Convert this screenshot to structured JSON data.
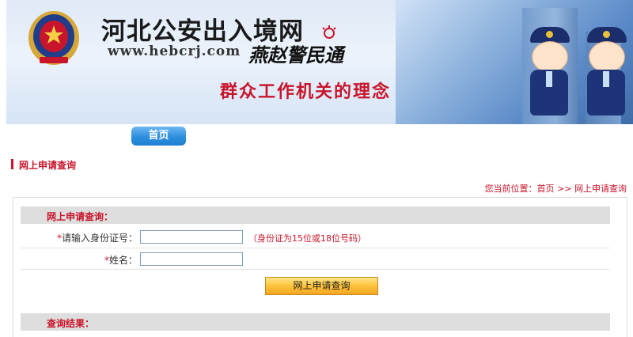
{
  "banner": {
    "site_title": "河北公安出入境网",
    "site_url": "www.hebcrj.com",
    "brand": "燕赵警民通",
    "slogan": "群众工作机关的理念"
  },
  "nav": {
    "home_label": "首页"
  },
  "section": {
    "title": "网上申请查询"
  },
  "breadcrumb": {
    "prefix": "您当前位置：",
    "home": "首页",
    "separator": ">>",
    "current": "网上申请查询"
  },
  "form": {
    "heading": "网上申请查询：",
    "required_mark": "*",
    "id_label": "请输入身份证号：",
    "id_value": "",
    "id_hint": "（身份证为15位或18位号码）",
    "name_label": "姓名：",
    "name_value": "",
    "submit_label": "网上申请查询"
  },
  "results": {
    "heading": "查询结果："
  },
  "colors": {
    "accent_red": "#c8152b",
    "nav_blue": "#2d8fe0",
    "button_orange": "#ffc23a"
  }
}
